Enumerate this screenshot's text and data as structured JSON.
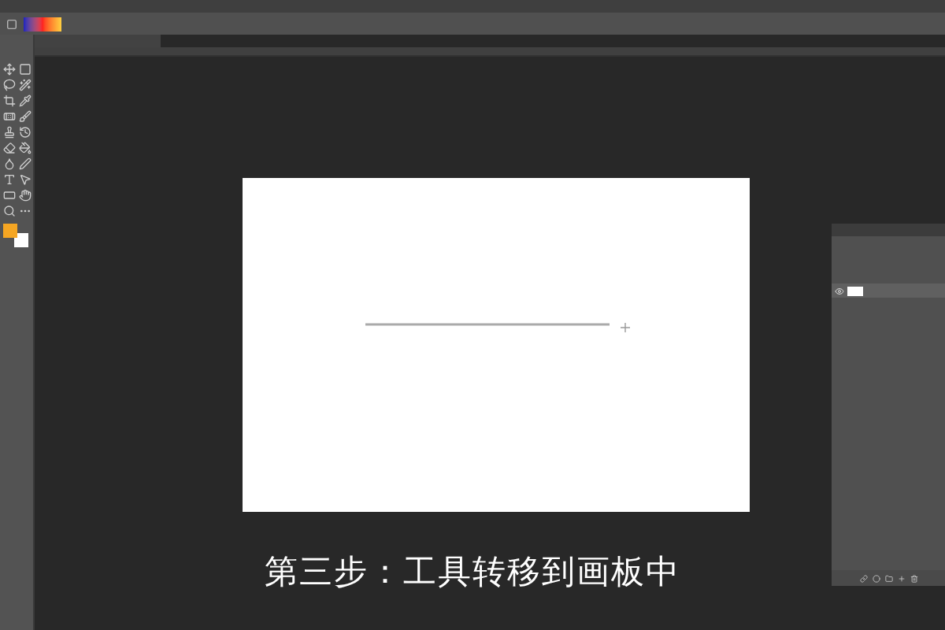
{
  "caption": "第三步：工具转移到画板中"
}
